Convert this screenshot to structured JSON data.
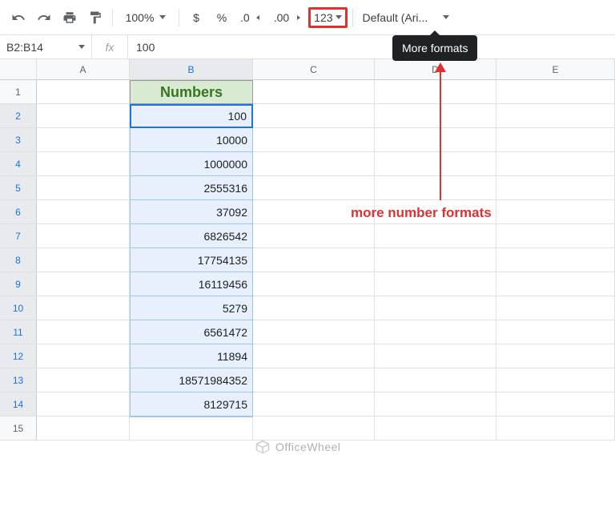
{
  "toolbar": {
    "zoom": "100%",
    "currency": "$",
    "percent": "%",
    "dec_decrease": ".0",
    "dec_increase": ".00",
    "more_formats": "123",
    "font": "Default (Ari..."
  },
  "tooltip": "More formats",
  "name_box": "B2:B14",
  "fx": "fx",
  "formula_value": "100",
  "columns": [
    "A",
    "B",
    "C",
    "D",
    "E"
  ],
  "rows": [
    "1",
    "2",
    "3",
    "4",
    "5",
    "6",
    "7",
    "8",
    "9",
    "10",
    "11",
    "12",
    "13",
    "14",
    "15"
  ],
  "header_label": "Numbers",
  "data": [
    "100",
    "10000",
    "1000000",
    "2555316",
    "37092",
    "6826542",
    "17754135",
    "16119456",
    "5279",
    "6561472",
    "11894",
    "18571984352",
    "8129715"
  ],
  "annotation": "more number formats",
  "watermark": "OfficeWheel"
}
